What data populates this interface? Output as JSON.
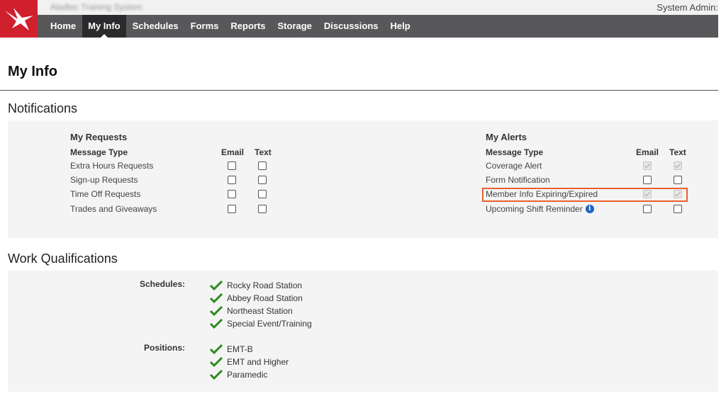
{
  "header": {
    "system_name": "Aladtec Training System",
    "user_label": "System Admin:"
  },
  "nav": {
    "items": [
      "Home",
      "My Info",
      "Schedules",
      "Forms",
      "Reports",
      "Storage",
      "Discussions",
      "Help"
    ],
    "active": "My Info"
  },
  "page": {
    "title": "My Info"
  },
  "notifications": {
    "section_title": "Notifications",
    "my_requests": {
      "title": "My Requests",
      "col_type": "Message Type",
      "col_email": "Email",
      "col_text": "Text",
      "rows": [
        {
          "label": "Extra Hours Requests",
          "email": false,
          "text": false
        },
        {
          "label": "Sign-up Requests",
          "email": false,
          "text": false
        },
        {
          "label": "Time Off Requests",
          "email": false,
          "text": false
        },
        {
          "label": "Trades and Giveaways",
          "email": false,
          "text": false
        }
      ]
    },
    "my_alerts": {
      "title": "My Alerts",
      "col_type": "Message Type",
      "col_email": "Email",
      "col_text": "Text",
      "rows": [
        {
          "label": "Coverage Alert",
          "email": true,
          "text": true,
          "disabled": true
        },
        {
          "label": "Form Notification",
          "email": false,
          "text": false,
          "disabled": false
        },
        {
          "label": "Member Info Expiring/Expired",
          "email": true,
          "text": true,
          "disabled": true
        },
        {
          "label": "Upcoming Shift Reminder",
          "email": false,
          "text": false,
          "disabled": false
        }
      ]
    }
  },
  "work_qualifications": {
    "section_title": "Work Qualifications",
    "schedules_label": "Schedules:",
    "schedules": [
      "Rocky Road Station",
      "Abbey Road Station",
      "Northeast Station",
      "Special Event/Training"
    ],
    "positions_label": "Positions:",
    "positions": [
      "EMT-B",
      "EMT and Higher",
      "Paramedic"
    ]
  },
  "colors": {
    "brand_red": "#d0202e",
    "nav_bg": "#58575a",
    "nav_active": "#2b2b2d",
    "highlight": "#e8622c",
    "check_green": "#2e8b1f",
    "info_blue": "#1b63c6"
  }
}
